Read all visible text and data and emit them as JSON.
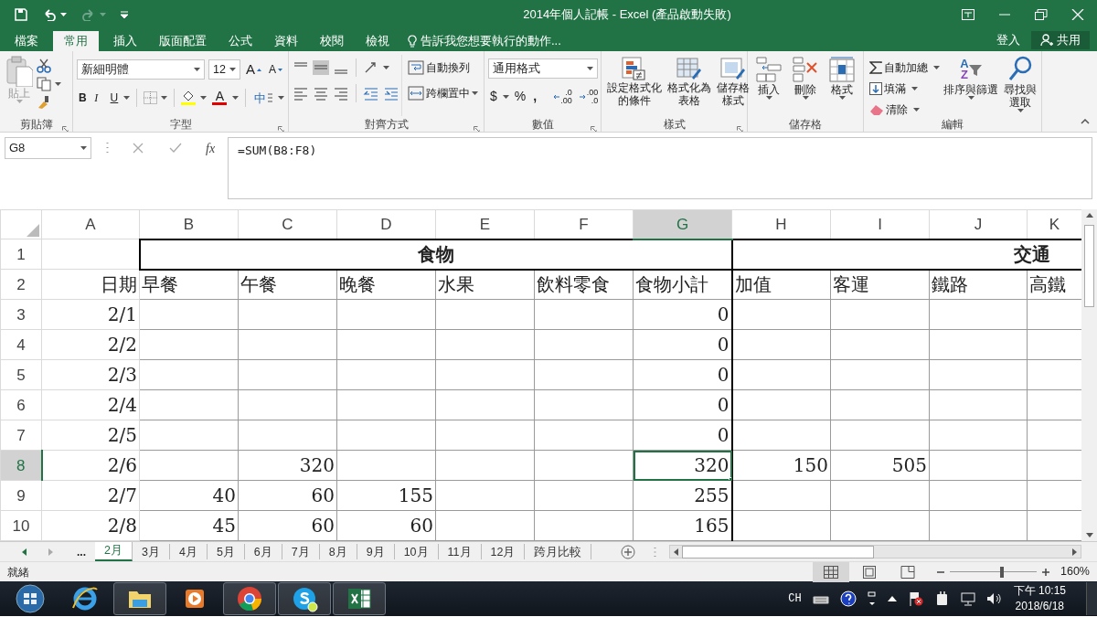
{
  "window": {
    "title": "2014年個人記帳 - Excel (產品啟動失敗)"
  },
  "ribbon_tabs": [
    {
      "label": "檔案",
      "selected": false
    },
    {
      "label": "常用",
      "selected": true
    },
    {
      "label": "插入",
      "selected": false
    },
    {
      "label": "版面配置",
      "selected": false
    },
    {
      "label": "公式",
      "selected": false
    },
    {
      "label": "資料",
      "selected": false
    },
    {
      "label": "校閱",
      "selected": false
    },
    {
      "label": "檢視",
      "selected": false
    }
  ],
  "tell_me": {
    "placeholder": "告訴我您想要執行的動作..."
  },
  "account": {
    "sign_in": "登入",
    "share": "共用"
  },
  "ribbon": {
    "clipboard": {
      "label": "剪貼簿",
      "paste": "貼上"
    },
    "font": {
      "label": "字型",
      "font_name": "新細明體",
      "font_size": "12",
      "grow": "A",
      "shrink": "A",
      "bold": "B",
      "italic": "I",
      "underline": "U",
      "font_color": "A",
      "phonetic": "中"
    },
    "alignment": {
      "label": "對齊方式",
      "wrap_text": "自動換列",
      "merge_center": "跨欄置中"
    },
    "number": {
      "label": "數值",
      "format": "通用格式",
      "currency": "$",
      "percent": "%",
      "comma": ",",
      "increase_decimal": [
        ".0",
        ".00"
      ],
      "decrease_decimal": [
        ".00",
        ".0"
      ]
    },
    "styles": {
      "label": "樣式",
      "buttons": [
        {
          "kind": "conditional",
          "lines": [
            "設定格式化",
            "的條件"
          ]
        },
        {
          "kind": "table",
          "lines": [
            "格式化為",
            "表格"
          ]
        },
        {
          "kind": "cellstyle",
          "lines": [
            "儲存格",
            "樣式"
          ]
        }
      ]
    },
    "cells": {
      "label": "儲存格",
      "buttons": [
        {
          "kind": "insert",
          "label": "插入"
        },
        {
          "kind": "delete",
          "label": "刪除"
        },
        {
          "kind": "format",
          "label": "格式"
        }
      ]
    },
    "editing": {
      "label": "編輯",
      "autosum": "自動加總",
      "fill": "填滿",
      "clear": "清除",
      "sort_letters": [
        "A",
        "Z"
      ],
      "sort": [
        "排序與篩選"
      ],
      "find": [
        "尋找與",
        "選取"
      ]
    }
  },
  "formula_bar": {
    "name_box": "G8",
    "fx": "fx",
    "formula": "=SUM(B8:F8)"
  },
  "sheet": {
    "columns": [
      {
        "label": "A",
        "selected": false
      },
      {
        "label": "B",
        "selected": false
      },
      {
        "label": "C",
        "selected": false
      },
      {
        "label": "D",
        "selected": false
      },
      {
        "label": "E",
        "selected": false
      },
      {
        "label": "F",
        "selected": false
      },
      {
        "label": "G",
        "selected": true
      },
      {
        "label": "H",
        "selected": false
      },
      {
        "label": "I",
        "selected": false
      },
      {
        "label": "J",
        "selected": false
      },
      {
        "label": "K",
        "selected": false
      }
    ],
    "rows": [
      {
        "header": "1",
        "kind": "band",
        "selected": false,
        "cells": [
          {},
          {
            "text": "食物",
            "colspan": 6
          },
          {
            "text": "交通",
            "colspan": 4
          }
        ]
      },
      {
        "header": "2",
        "kind": "heading",
        "selected": false,
        "cells": [
          "日期",
          "早餐",
          "午餐",
          "晚餐",
          "水果",
          "飲料零食",
          "食物小計",
          "加值",
          "客運",
          "鐵路",
          "高鐵"
        ]
      },
      {
        "header": "3",
        "kind": "data",
        "selected": false,
        "cells": [
          "2/1",
          "",
          "",
          "",
          "",
          "",
          "0",
          "",
          "",
          "",
          ""
        ]
      },
      {
        "header": "4",
        "kind": "data",
        "selected": false,
        "cells": [
          "2/2",
          "",
          "",
          "",
          "",
          "",
          "0",
          "",
          "",
          "",
          ""
        ]
      },
      {
        "header": "5",
        "kind": "data",
        "selected": false,
        "cells": [
          "2/3",
          "",
          "",
          "",
          "",
          "",
          "0",
          "",
          "",
          "",
          ""
        ]
      },
      {
        "header": "6",
        "kind": "data",
        "selected": false,
        "cells": [
          "2/4",
          "",
          "",
          "",
          "",
          "",
          "0",
          "",
          "",
          "",
          ""
        ]
      },
      {
        "header": "7",
        "kind": "data",
        "selected": false,
        "cells": [
          "2/5",
          "",
          "",
          "",
          "",
          "",
          "0",
          "",
          "",
          "",
          ""
        ]
      },
      {
        "header": "8",
        "kind": "data",
        "selected": true,
        "cells": [
          "2/6",
          "",
          "320",
          "",
          "",
          "",
          "320",
          "150",
          "505",
          "",
          ""
        ]
      },
      {
        "header": "9",
        "kind": "data",
        "selected": false,
        "cells": [
          "2/7",
          "40",
          "60",
          "155",
          "",
          "",
          "255",
          "",
          "",
          "",
          ""
        ]
      },
      {
        "header": "10",
        "kind": "data",
        "selected": false,
        "cells": [
          "2/8",
          "45",
          "60",
          "60",
          "",
          "",
          "165",
          "",
          "",
          "",
          ""
        ]
      }
    ]
  },
  "sheet_tabs": {
    "more": "...",
    "tabs": [
      {
        "label": "2月",
        "selected": true
      },
      {
        "label": "3月",
        "selected": false
      },
      {
        "label": "4月",
        "selected": false
      },
      {
        "label": "5月",
        "selected": false
      },
      {
        "label": "6月",
        "selected": false
      },
      {
        "label": "7月",
        "selected": false
      },
      {
        "label": "8月",
        "selected": false
      },
      {
        "label": "9月",
        "selected": false
      },
      {
        "label": "10月",
        "selected": false
      },
      {
        "label": "11月",
        "selected": false
      },
      {
        "label": "12月",
        "selected": false
      },
      {
        "label": "跨月比較",
        "selected": false
      }
    ]
  },
  "status_bar": {
    "status": "就緒",
    "views": [
      {
        "kind": "normal",
        "selected": true
      },
      {
        "kind": "page_layout",
        "selected": false
      },
      {
        "kind": "page_break",
        "selected": false
      }
    ],
    "zoom": {
      "level": 0.6,
      "reading": "160%"
    }
  },
  "taskbar": {
    "apps": [
      {
        "kind": "start",
        "running": false
      },
      {
        "kind": "ie",
        "running": false
      },
      {
        "kind": "explorer",
        "running": true
      },
      {
        "kind": "media",
        "running": false
      },
      {
        "kind": "chrome",
        "running": true
      },
      {
        "kind": "skype",
        "running": true
      },
      {
        "kind": "excel",
        "running": true
      }
    ],
    "ime": "CH",
    "time": "下午 10:15",
    "date": "2018/6/18"
  }
}
